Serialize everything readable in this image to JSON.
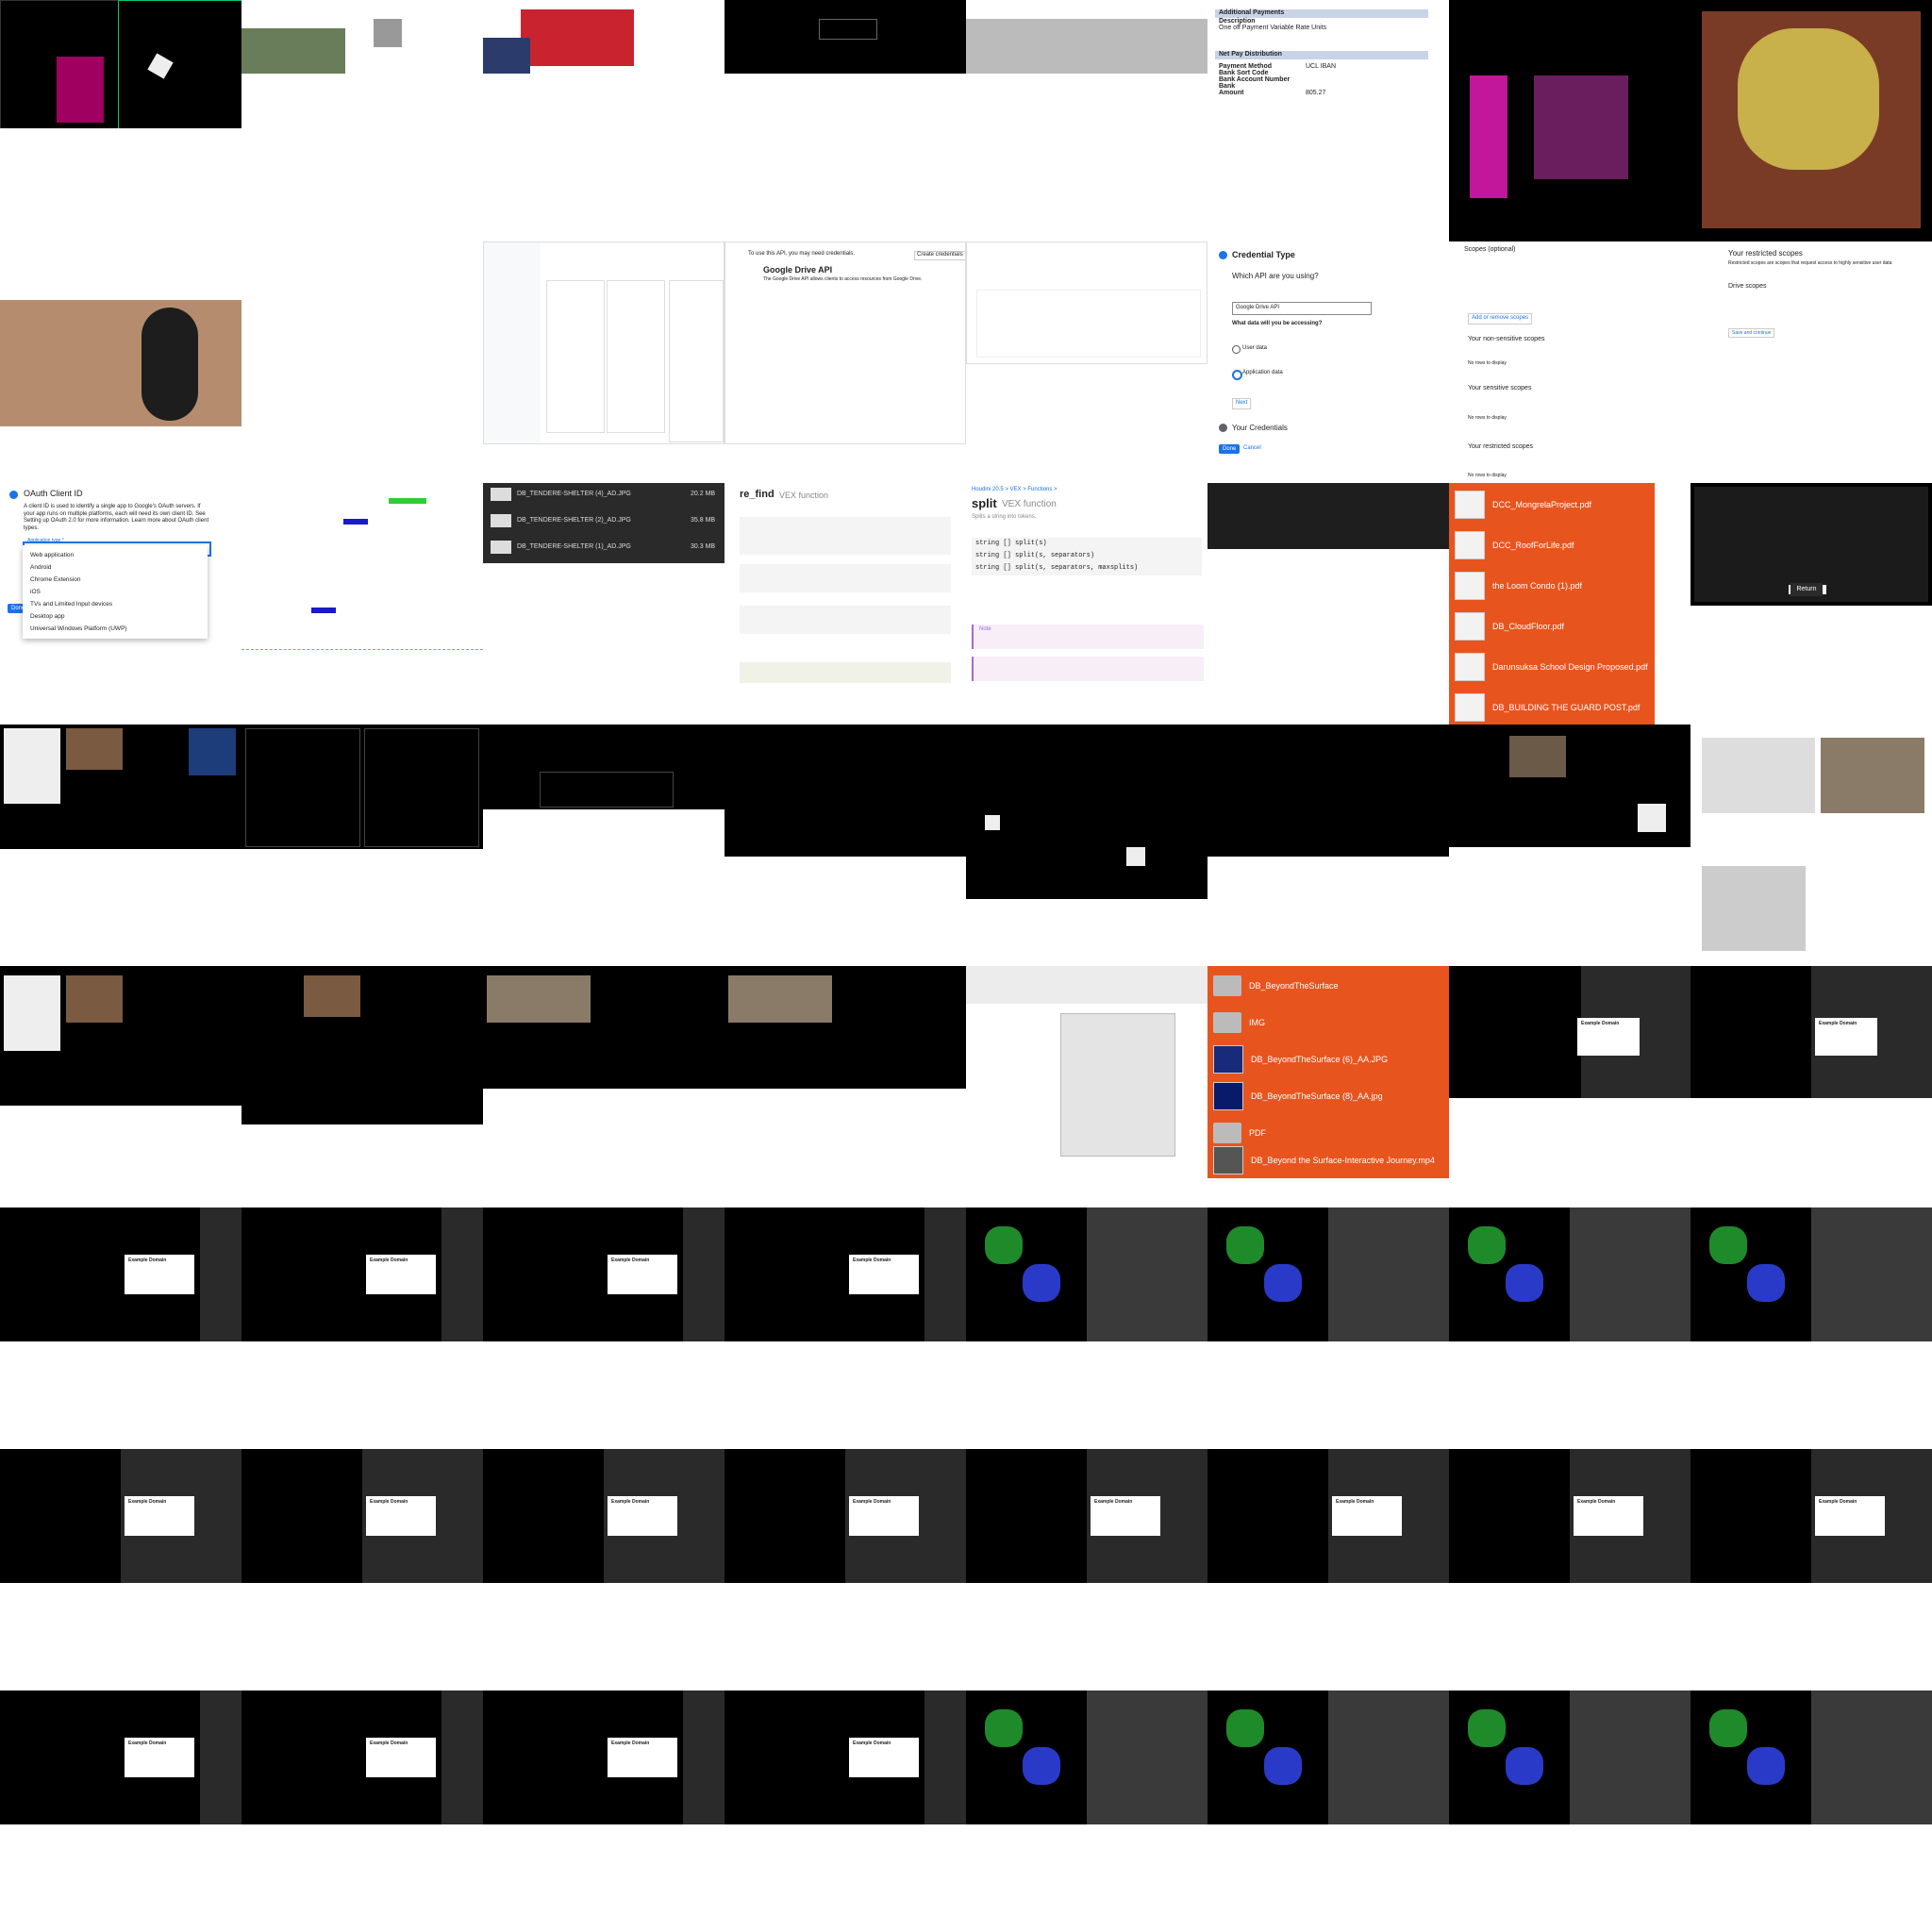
{
  "payments": {
    "additional_title": "Additional Payments",
    "description_label": "Description",
    "description_value": "One off Payment Variable Rate Units",
    "net_title": "Net Pay Distribution",
    "rows": [
      {
        "label": "Payment Method",
        "value": "UCL IBAN"
      },
      {
        "label": "Bank Sort Code",
        "value": ""
      },
      {
        "label": "Bank Account Number",
        "value": ""
      },
      {
        "label": "Bank",
        "value": ""
      },
      {
        "label": "Amount",
        "value": "805.27"
      }
    ]
  },
  "drive_api": {
    "heading": "Google Drive API",
    "description": "The Google Drive API allows clients to access resources from Google Drive.",
    "creds_notice": "To use this API, you may need credentials.",
    "create_creds": "Create credentials"
  },
  "credential_type": {
    "title": "Credential Type",
    "question": "Which API are you using?",
    "api_select": "Google Drive API",
    "data_question": "What data will you be accessing?",
    "user_data": "User data",
    "app_data": "Application data",
    "next": "Next",
    "your_credentials": "Your Credentials",
    "done": "Done",
    "cancel": "Cancel"
  },
  "scopes": {
    "title": "Scopes (optional)",
    "non_sensitive": "Your non-sensitive scopes",
    "sensitive": "Your sensitive scopes",
    "restricted": "Your restricted scopes",
    "no_rows": "No rows to display",
    "add_remove": "Add or remove scopes",
    "restricted_title": "Your restricted scopes",
    "restricted_desc": "Restricted scopes are scopes that request access to highly sensitive user data",
    "drive_scopes": "Drive scopes",
    "save_continue": "Save and continue"
  },
  "oauth": {
    "title": "OAuth Client ID",
    "desc": "A client ID is used to identify a single app to Google's OAuth servers. If your app runs on multiple platforms, each will need its own client ID. See Setting up OAuth 2.0 for more information. Learn more about OAuth client types.",
    "app_type_label": "Application type *",
    "options": [
      "Web application",
      "Android",
      "Chrome Extension",
      "iOS",
      "TVs and Limited Input devices",
      "Desktop app",
      "Universal Windows Platform (UWP)"
    ],
    "done": "Done"
  },
  "files_dark": [
    {
      "name": "DB_TENDERE-SHELTER (4)_AD.JPG",
      "size": "20.2 MB"
    },
    {
      "name": "DB_TENDERE-SHELTER (2)_AD.JPG",
      "size": "35.8 MB"
    },
    {
      "name": "DB_TENDERE-SHELTER (1)_AD.JPG",
      "size": "30.3 MB"
    }
  ],
  "re_find": {
    "title": "re_find",
    "subtitle": "VEX function"
  },
  "split": {
    "breadcrumb": "Houdini 20.5 > VEX > Functions >",
    "title": "split",
    "subtitle": "VEX function",
    "desc": "Splits a string into tokens.",
    "sig1": "string [] split(s)",
    "sig2": "string [] split(s, separators)",
    "sig3": "string [] split(s, separators, maxsplits)",
    "note_label": "Note"
  },
  "pdf_list": [
    "DCC_MongrelaProject.pdf",
    "DCC_RoofForLife.pdf",
    "the Loom Condo (1).pdf",
    "DB_CloudFloor.pdf",
    "Darunsuksa School Design Proposed.pdf",
    "DB_BUILDING THE GUARD POST.pdf"
  ],
  "folder_list": [
    {
      "kind": "folder",
      "name": "DB_BeyondTheSurface"
    },
    {
      "kind": "folder",
      "name": "IMG"
    },
    {
      "kind": "image",
      "name": "DB_BeyondTheSurface (6)_AA.JPG"
    },
    {
      "kind": "image",
      "name": "DB_BeyondTheSurface (8)_AA.jpg"
    },
    {
      "kind": "folder",
      "name": "PDF"
    },
    {
      "kind": "video",
      "name": "DB_Beyond the Surface-Interactive Journey.mp4"
    }
  ],
  "return_button": "Return",
  "dialog_title": "Example Domain",
  "colors": {
    "orange": "#e8541e",
    "blue": "#1a73e8"
  }
}
